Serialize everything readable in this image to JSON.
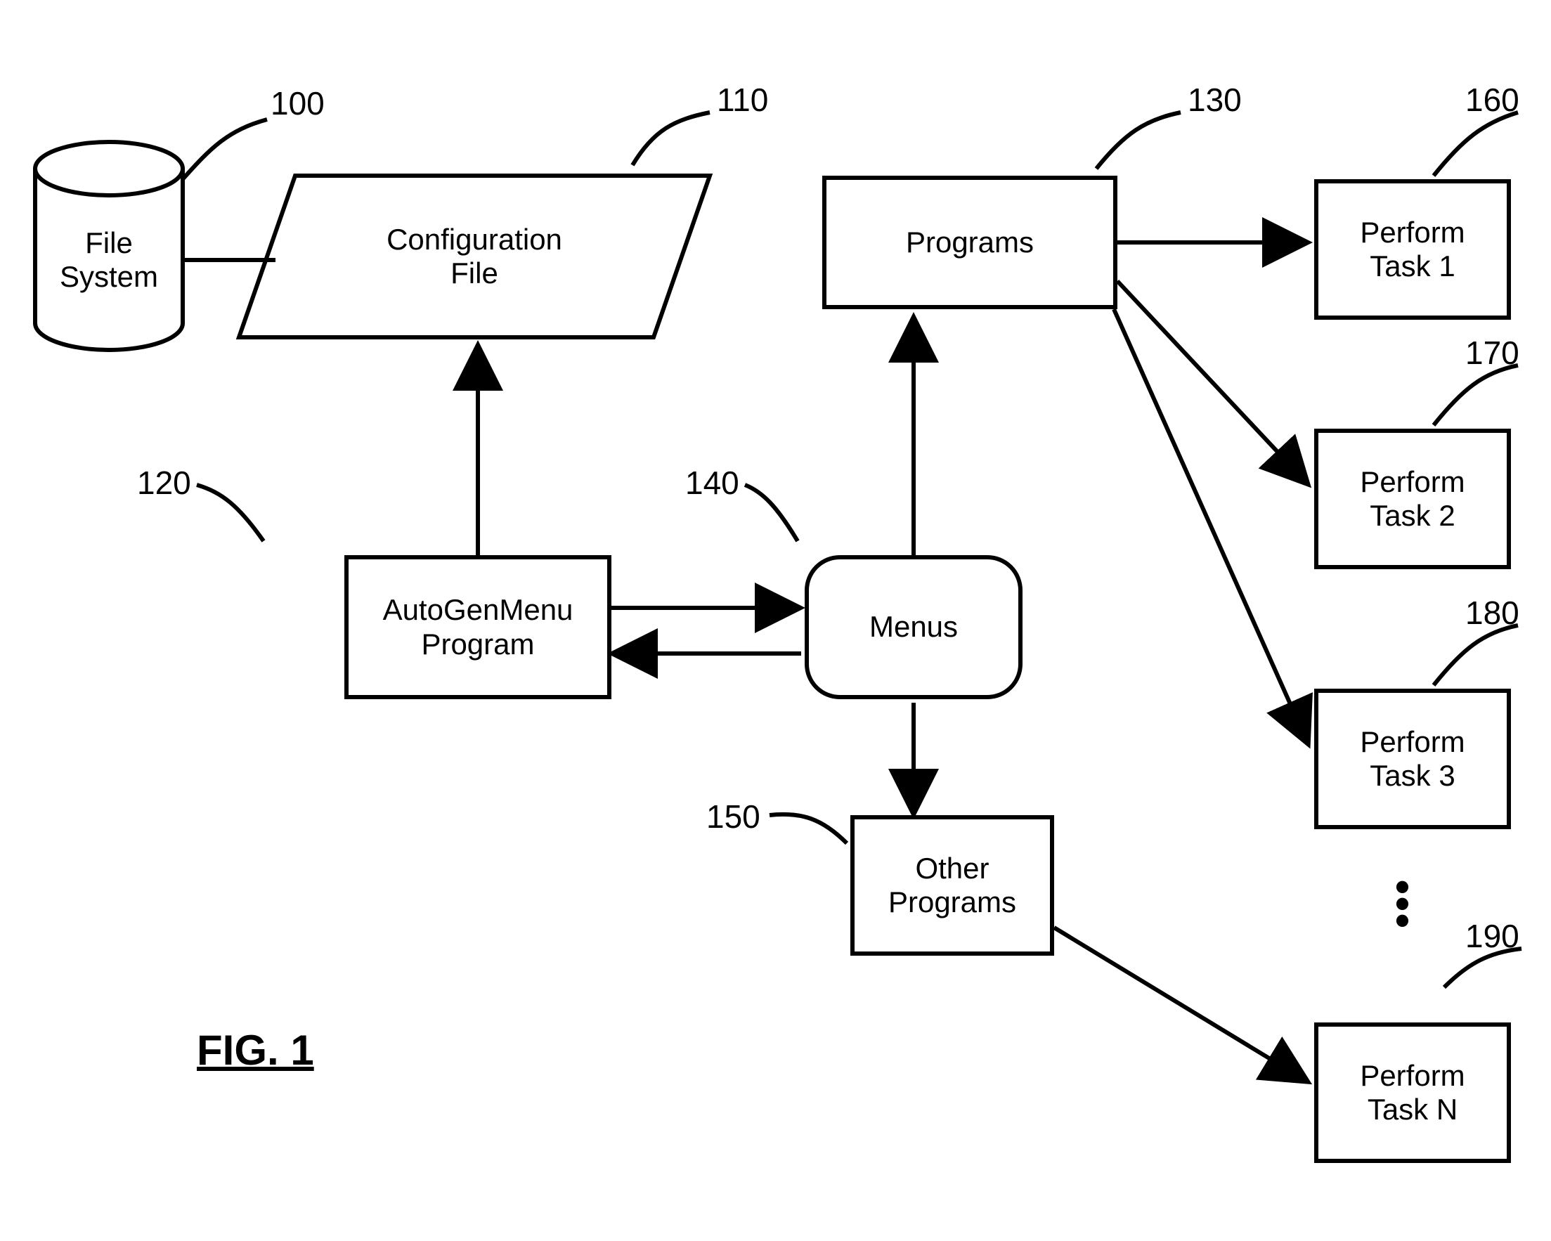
{
  "figure_label": "FIG. 1",
  "nodes": {
    "file_system": {
      "ref": "100",
      "text": "File\nSystem"
    },
    "config_file": {
      "ref": "110",
      "text": "Configuration\nFile"
    },
    "autogen": {
      "ref": "120",
      "text": "AutoGenMenu\nProgram"
    },
    "programs": {
      "ref": "130",
      "text": "Programs"
    },
    "menus": {
      "ref": "140",
      "text": "Menus"
    },
    "other": {
      "ref": "150",
      "text": "Other\nPrograms"
    },
    "task1": {
      "ref": "160",
      "text": "Perform\nTask 1"
    },
    "task2": {
      "ref": "170",
      "text": "Perform\nTask 2"
    },
    "task3": {
      "ref": "180",
      "text": "Perform\nTask 3"
    },
    "taskn": {
      "ref": "190",
      "text": "Perform\nTask N"
    }
  }
}
